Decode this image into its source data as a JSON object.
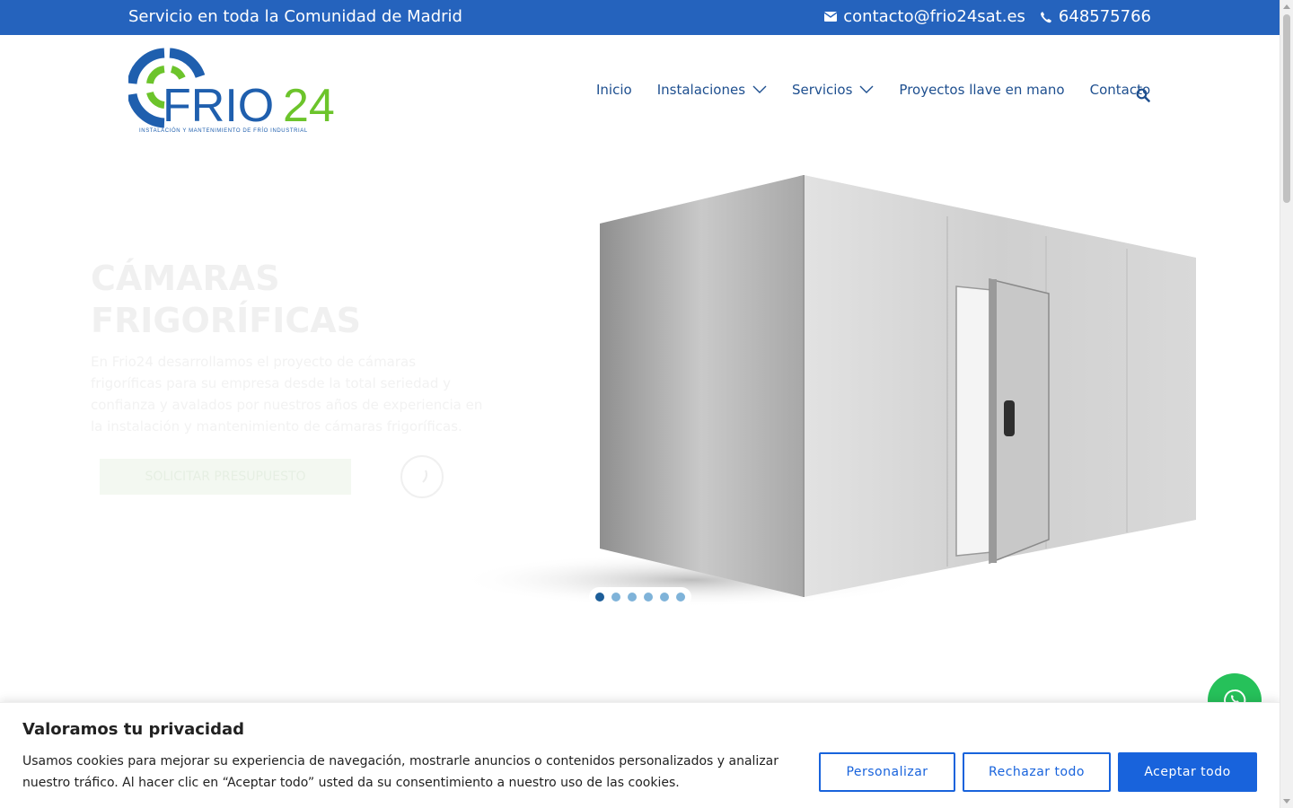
{
  "topbar": {
    "service_area": "Servicio en toda la Comunidad de Madrid",
    "email": "contacto@frio24sat.es",
    "phone": "648575766"
  },
  "logo": {
    "brand": "FRIO24",
    "tagline": "INSTALACIÓN Y MANTENIMIENTO DE FRÍO INDUSTRIAL"
  },
  "nav": {
    "items": [
      {
        "label": "Inicio"
      },
      {
        "label": "Instalaciones"
      },
      {
        "label": "Servicios"
      },
      {
        "label": "Proyectos llave en mano"
      },
      {
        "label": "Contacto"
      }
    ]
  },
  "hero": {
    "title": "CÁMARAS FRIGORÍFICAS",
    "description": "En Frio24 desarrollamos el proyecto de cámaras frigoríficas para su empresa desde la total seriedad y confianza y avalados por nuestros años de experiencia en la instalación y mantenimiento de cámaras frigoríficas.",
    "cta_label": "SOLICITAR PRESUPUESTO"
  },
  "slider": {
    "total": 6,
    "active": 1
  },
  "cookie": {
    "title": "Valoramos tu privacidad",
    "text": "Usamos cookies para mejorar su experiencia de navegación, mostrarle anuncios o contenidos personalizados y analizar nuestro tráfico. Al hacer clic en “Aceptar todo” usted da su consentimiento a nuestro uso de las cookies.",
    "customize_label": "Personalizar",
    "reject_label": "Rechazar todo",
    "accept_label": "Aceptar todo"
  },
  "colors": {
    "topbar": "#2563bd",
    "nav_text": "#1e4f8f",
    "logo_blue": "#1f5fae",
    "logo_green": "#6cc42b",
    "cookie_button": "#1863dc",
    "whatsapp": "#26c15a"
  },
  "icons": [
    "envelope-icon",
    "phone-icon",
    "search-icon",
    "chevron-down-icon",
    "whatsapp-icon"
  ]
}
